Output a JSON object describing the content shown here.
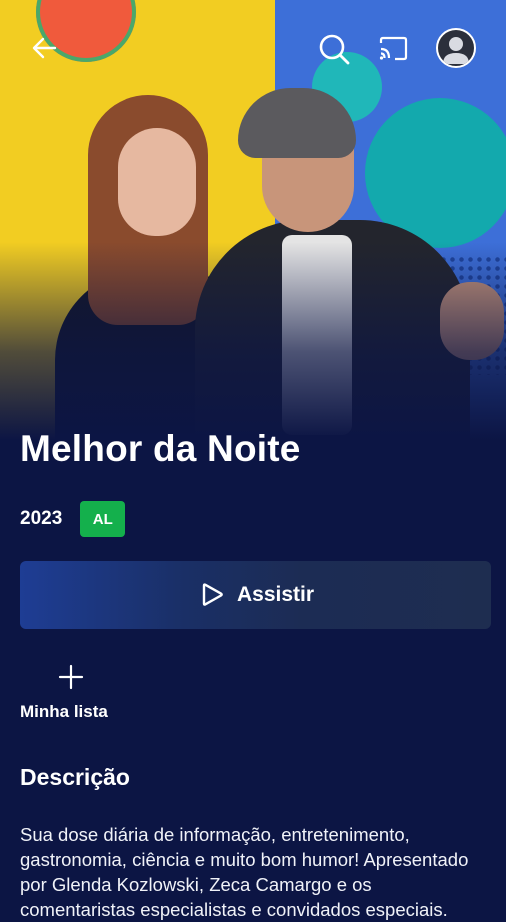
{
  "topbar": {
    "back_icon": "arrow-left-icon",
    "search_icon": "search-icon",
    "cast_icon": "cast-icon",
    "avatar_icon": "user-avatar-icon"
  },
  "show": {
    "title": "Melhor da Noite",
    "year": "2023",
    "rating": "AL",
    "rating_color": "#14b04c"
  },
  "actions": {
    "watch_label": "Assistir",
    "watch_icon": "play-outline-icon",
    "mylist_label": "Minha lista",
    "mylist_icon": "plus-icon"
  },
  "description": {
    "heading": "Descrição",
    "text": "Sua dose diária de informação, entretenimento, gastronomia, ciência e muito bom humor! Apresentado por Glenda Kozlowski, Zeca Camargo e os comentaristas especialistas e convidados especiais."
  },
  "colors": {
    "background": "#0c1544",
    "hero_yellow": "#f2cd22",
    "hero_blue": "#3d6fd8",
    "accent_teal": "#13a9ad"
  }
}
